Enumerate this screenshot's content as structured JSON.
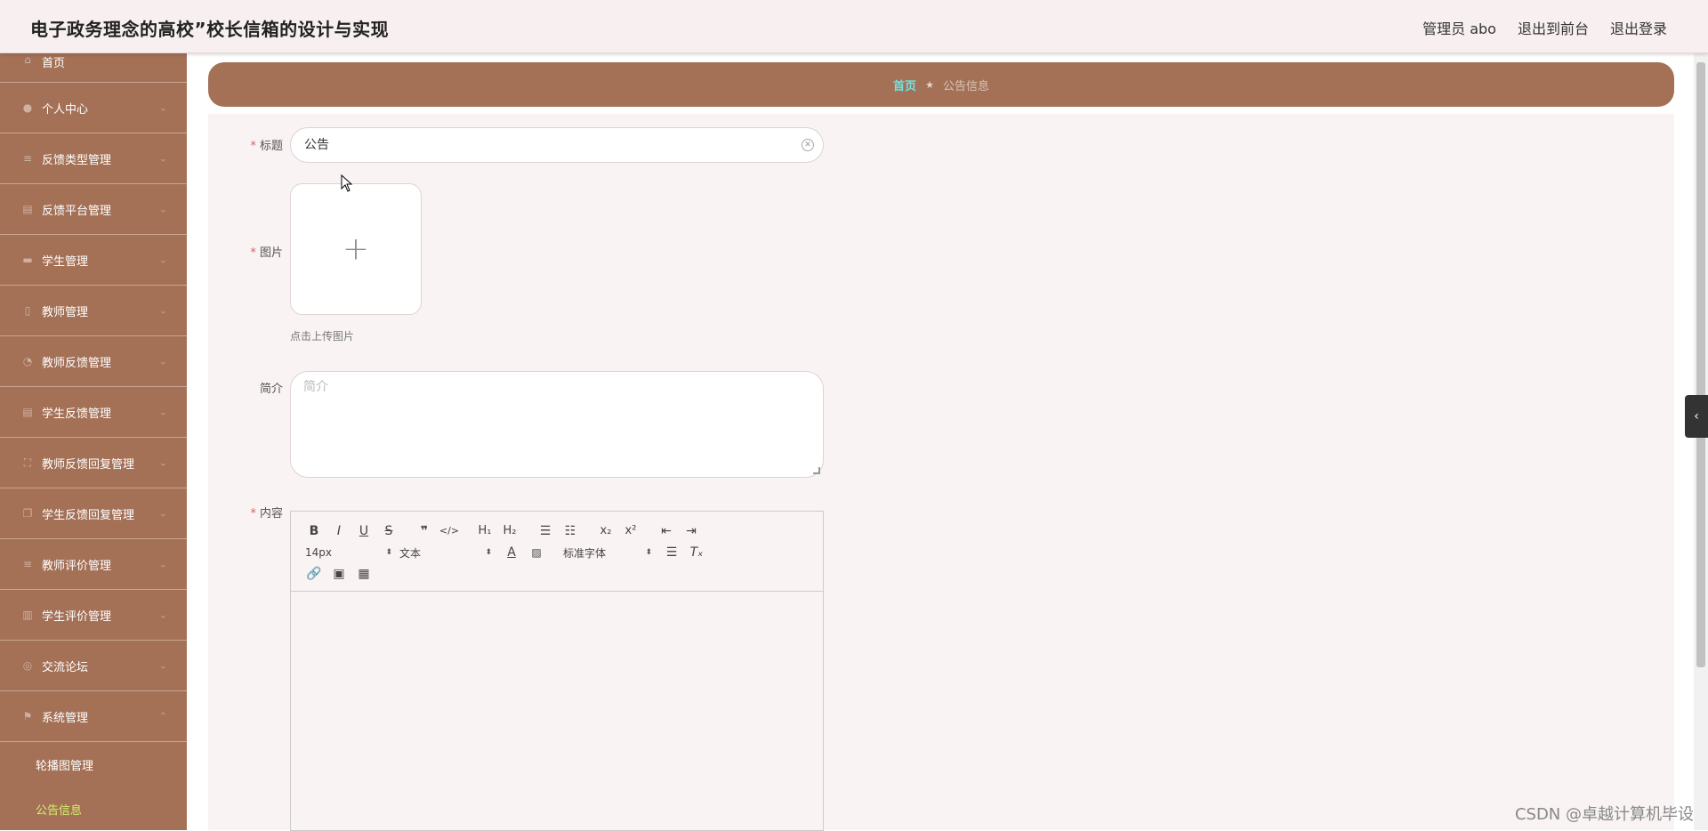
{
  "header": {
    "app_title": "电子政务理念的高校”校长信箱的设计与实现",
    "user_label": "管理员 abo",
    "back_to_front": "退出到前台",
    "logout": "退出登录"
  },
  "sidebar": {
    "items": [
      {
        "label": "首页",
        "icon": "home-icon"
      },
      {
        "label": "个人中心",
        "icon": "user-icon"
      },
      {
        "label": "反馈类型管理",
        "icon": "list-icon"
      },
      {
        "label": "反馈平台管理",
        "icon": "clipboard-icon"
      },
      {
        "label": "学生管理",
        "icon": "chat-icon"
      },
      {
        "label": "教师管理",
        "icon": "mic-icon"
      },
      {
        "label": "教师反馈管理",
        "icon": "gauge-icon"
      },
      {
        "label": "学生反馈管理",
        "icon": "clipboard-icon"
      },
      {
        "label": "教师反馈回复管理",
        "icon": "fullscreen-icon"
      },
      {
        "label": "学生反馈回复管理",
        "icon": "copy-icon"
      },
      {
        "label": "教师评价管理",
        "icon": "list-icon"
      },
      {
        "label": "学生评价管理",
        "icon": "bar-chart-icon"
      },
      {
        "label": "交流论坛",
        "icon": "help-icon"
      },
      {
        "label": "系统管理",
        "icon": "flag-icon"
      }
    ],
    "sub_items": [
      "轮播图管理",
      "公告信息"
    ],
    "active_color": "#d4f26a",
    "bg_color": "#a47157"
  },
  "breadcrumb": {
    "home": "首页",
    "current": "公告信息"
  },
  "form": {
    "title_label": "标题",
    "title_value": "公告",
    "image_label": "图片",
    "upload_tip": "点击上传图片",
    "summary_label": "简介",
    "summary_placeholder": "简介",
    "content_label": "内容"
  },
  "editor": {
    "font_size": "14px",
    "text_type": "文本",
    "font_family": "标准字体"
  },
  "watermark": "CSDN @卓越计算机毕设"
}
